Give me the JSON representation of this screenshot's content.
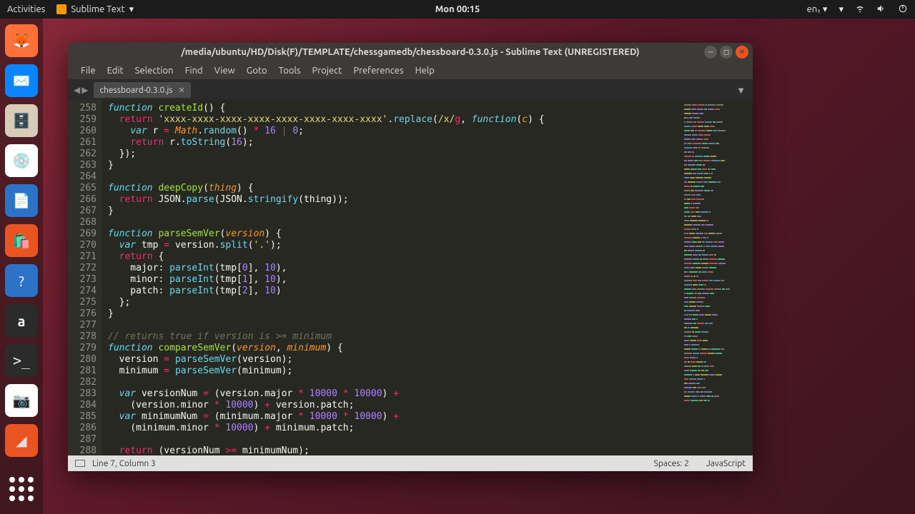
{
  "panel": {
    "activities": "Activities",
    "app_indicator": "Sublime Text",
    "clock": "Mon 00:15",
    "lang": "en₁"
  },
  "dock": {
    "items": [
      "firefox",
      "thunderbird",
      "files",
      "disks",
      "writer",
      "software",
      "help",
      "amazon",
      "terminal",
      "screenshot",
      "sublime"
    ]
  },
  "window": {
    "title": "/media/ubuntu/HD/Disk(F)/TEMPLATE/chessgamedb/chessboard-0.3.0.js - Sublime Text (UNREGISTERED)",
    "menu": [
      "File",
      "Edit",
      "Selection",
      "Find",
      "View",
      "Goto",
      "Tools",
      "Project",
      "Preferences",
      "Help"
    ],
    "tab": "chessboard-0.3.0.js",
    "status_left": "Line 7, Column 3",
    "status_spaces": "Spaces: 2",
    "status_lang": "JavaScript",
    "first_line": 258,
    "code_lines": [
      "<span class='kw'>function</span> <span class='fn'>createId</span>() {",
      "  <span class='kw2'>return</span> <span class='str'>'xxxx-xxxx-xxxx-xxxx-xxxx-xxxx-xxxx-xxxx'</span>.<span class='call'>replace</span>(<span class='str'>/x/</span><span class='op'>g</span>, <span class='kw'>function</span>(<span class='arg'>c</span>) {",
      "    <span class='kw'>var</span> r <span class='op'>=</span> <span class='arg'>Math</span>.<span class='call'>random</span>() <span class='op'>*</span> <span class='num'>16</span> <span class='op'>|</span> <span class='num'>0</span>;",
      "    <span class='kw2'>return</span> r.<span class='call'>toString</span>(<span class='num'>16</span>);",
      "  });",
      "}",
      "",
      "<span class='kw'>function</span> <span class='fn'>deepCopy</span>(<span class='arg'>thing</span>) {",
      "  <span class='kw2'>return</span> JSON.<span class='call'>parse</span>(JSON.<span class='call'>stringify</span>(thing));",
      "}",
      "",
      "<span class='kw'>function</span> <span class='fn'>parseSemVer</span>(<span class='arg'>version</span>) {",
      "  <span class='kw'>var</span> tmp <span class='op'>=</span> version.<span class='call'>split</span>(<span class='str'>'.'</span>);",
      "  <span class='kw2'>return</span> {",
      "    major: <span class='call'>parseInt</span>(tmp[<span class='num'>0</span>], <span class='num'>10</span>),",
      "    minor: <span class='call'>parseInt</span>(tmp[<span class='num'>1</span>], <span class='num'>10</span>),",
      "    patch: <span class='call'>parseInt</span>(tmp[<span class='num'>2</span>], <span class='num'>10</span>)",
      "  };",
      "}",
      "",
      "<span class='cm'>// returns true if version is >= minimum</span>",
      "<span class='kw'>function</span> <span class='fn'>compareSemVer</span>(<span class='arg'>version</span>, <span class='arg'>minimum</span>) {",
      "  version <span class='op'>=</span> <span class='call'>parseSemVer</span>(version);",
      "  minimum <span class='op'>=</span> <span class='call'>parseSemVer</span>(minimum);",
      "",
      "  <span class='kw'>var</span> versionNum <span class='op'>=</span> (version.major <span class='op'>*</span> <span class='num'>10000</span> <span class='op'>*</span> <span class='num'>10000</span>) <span class='op'>+</span>",
      "    (version.minor <span class='op'>*</span> <span class='num'>10000</span>) <span class='op'>+</span> version.patch;",
      "  <span class='kw'>var</span> minimumNum <span class='op'>=</span> (minimum.major <span class='op'>*</span> <span class='num'>10000</span> <span class='op'>*</span> <span class='num'>10000</span>) <span class='op'>+</span>",
      "    (minimum.minor <span class='op'>*</span> <span class='num'>10000</span>) <span class='op'>+</span> minimum.patch;",
      "",
      "  <span class='kw2'>return</span> (versionNum <span class='op'>>=</span> minimumNum);"
    ]
  }
}
